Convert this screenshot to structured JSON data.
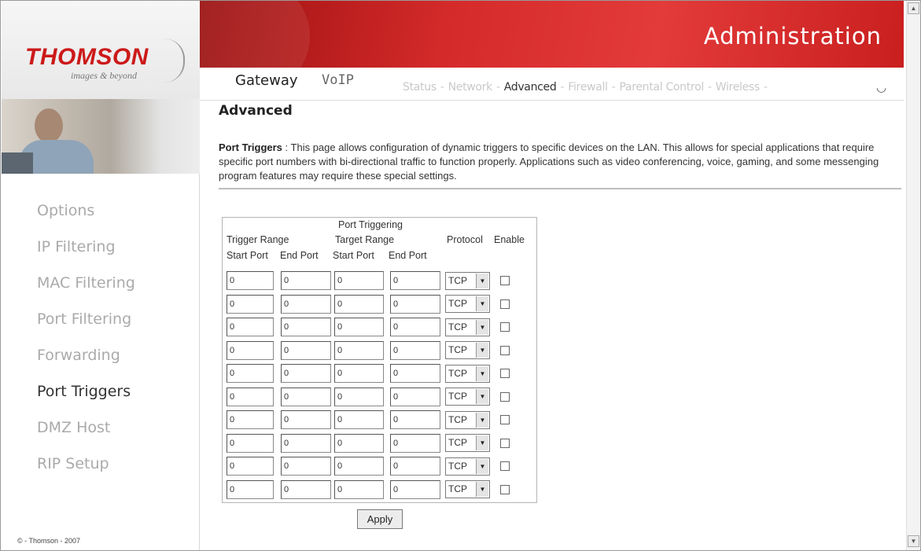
{
  "brand": {
    "logo_text": "THOMSON",
    "tagline": "images & beyond"
  },
  "header": {
    "title": "Administration"
  },
  "top_nav": {
    "tabs": [
      {
        "label": "Gateway",
        "active": true
      },
      {
        "label": "VoIP",
        "active": false
      }
    ],
    "sub_links": [
      {
        "label": "Status",
        "active": false
      },
      {
        "label": "Network",
        "active": false
      },
      {
        "label": "Advanced",
        "active": true
      },
      {
        "label": "Firewall",
        "active": false
      },
      {
        "label": "Parental Control",
        "active": false
      },
      {
        "label": "Wireless",
        "active": false
      }
    ],
    "separator": "-"
  },
  "sidebar": {
    "items": [
      {
        "label": "Options",
        "active": false
      },
      {
        "label": "IP Filtering",
        "active": false
      },
      {
        "label": "MAC Filtering",
        "active": false
      },
      {
        "label": "Port Filtering",
        "active": false
      },
      {
        "label": "Forwarding",
        "active": false
      },
      {
        "label": "Port Triggers",
        "active": true
      },
      {
        "label": "DMZ Host",
        "active": false
      },
      {
        "label": "RIP Setup",
        "active": false
      }
    ],
    "copyright": "© - Thomson - 2007"
  },
  "content": {
    "title": "Advanced",
    "intro_heading": "Port Triggers",
    "intro_sep": " :  ",
    "intro_text": "This page allows configuration of dynamic triggers to specific devices on the LAN. This allows for special applications that require specific port numbers with bi-directional traffic to function properly. Applications such as video conferencing, voice, gaming, and some messenging program features may require these special settings."
  },
  "table": {
    "caption": "Port Triggering",
    "group_trigger": "Trigger Range",
    "group_target": "Target Range",
    "col_protocol": "Protocol",
    "col_enable": "Enable",
    "col_start_port": "Start Port",
    "col_end_port": "End Port",
    "rows": [
      {
        "trigger_start": "0",
        "trigger_end": "0",
        "target_start": "0",
        "target_end": "0",
        "protocol": "TCP",
        "enabled": false
      },
      {
        "trigger_start": "0",
        "trigger_end": "0",
        "target_start": "0",
        "target_end": "0",
        "protocol": "TCP",
        "enabled": false
      },
      {
        "trigger_start": "0",
        "trigger_end": "0",
        "target_start": "0",
        "target_end": "0",
        "protocol": "TCP",
        "enabled": false
      },
      {
        "trigger_start": "0",
        "trigger_end": "0",
        "target_start": "0",
        "target_end": "0",
        "protocol": "TCP",
        "enabled": false
      },
      {
        "trigger_start": "0",
        "trigger_end": "0",
        "target_start": "0",
        "target_end": "0",
        "protocol": "TCP",
        "enabled": false
      },
      {
        "trigger_start": "0",
        "trigger_end": "0",
        "target_start": "0",
        "target_end": "0",
        "protocol": "TCP",
        "enabled": false
      },
      {
        "trigger_start": "0",
        "trigger_end": "0",
        "target_start": "0",
        "target_end": "0",
        "protocol": "TCP",
        "enabled": false
      },
      {
        "trigger_start": "0",
        "trigger_end": "0",
        "target_start": "0",
        "target_end": "0",
        "protocol": "TCP",
        "enabled": false
      },
      {
        "trigger_start": "0",
        "trigger_end": "0",
        "target_start": "0",
        "target_end": "0",
        "protocol": "TCP",
        "enabled": false
      },
      {
        "trigger_start": "0",
        "trigger_end": "0",
        "target_start": "0",
        "target_end": "0",
        "protocol": "TCP",
        "enabled": false
      }
    ]
  },
  "actions": {
    "apply_label": "Apply"
  },
  "colors": {
    "header_red": "#d42a2a",
    "logo_red": "#cc1a1a",
    "nav_inactive": "#aaaaaa",
    "nav_active": "#333333"
  },
  "icons": {
    "dropdown": "triangle-down",
    "scroll_up": "triangle-up",
    "scroll_down": "triangle-down",
    "spinner": "loading-spinner"
  }
}
